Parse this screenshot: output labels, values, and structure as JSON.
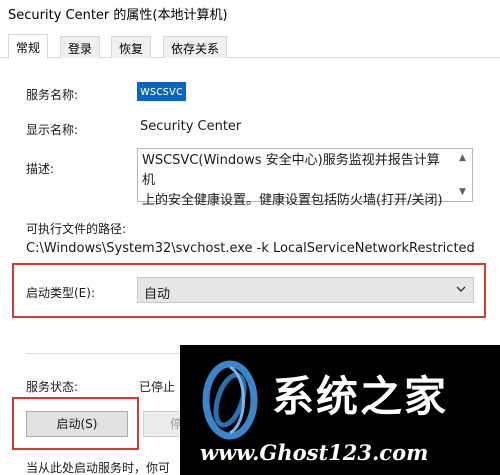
{
  "window": {
    "title": "Security Center 的属性(本地计算机)"
  },
  "tabs": [
    {
      "label": "常规",
      "active": true
    },
    {
      "label": "登录",
      "active": false
    },
    {
      "label": "恢复",
      "active": false
    },
    {
      "label": "依存关系",
      "active": false
    }
  ],
  "general": {
    "service_name_label": "服务名称:",
    "service_name_value": "wscsvc",
    "display_name_label": "显示名称:",
    "display_name_value": "Security Center",
    "description_label": "描述:",
    "description_line1": "WSCSVC(Windows 安全中心)服务监视并报告计算机",
    "description_line2": "上的安全健康设置。健康设置包括防火墙(打开/关闭)",
    "exe_path_label": "可执行文件的路径:",
    "exe_path_value": "C:\\Windows\\System32\\svchost.exe -k LocalServiceNetworkRestricted",
    "startup_type_label": "启动类型(E):",
    "startup_type_value": "自动",
    "service_status_label": "服务状态:",
    "service_status_value": "已停止",
    "start_button_label": "启动(S)",
    "stop_button_label": "停",
    "bottom_note": "当从此处启动服务时，你可"
  },
  "watermark": {
    "text": "系统之家",
    "url": "www.Ghost123.com"
  },
  "colors": {
    "highlight": "#0a64c8",
    "annotation_red": "#d23a3a"
  }
}
